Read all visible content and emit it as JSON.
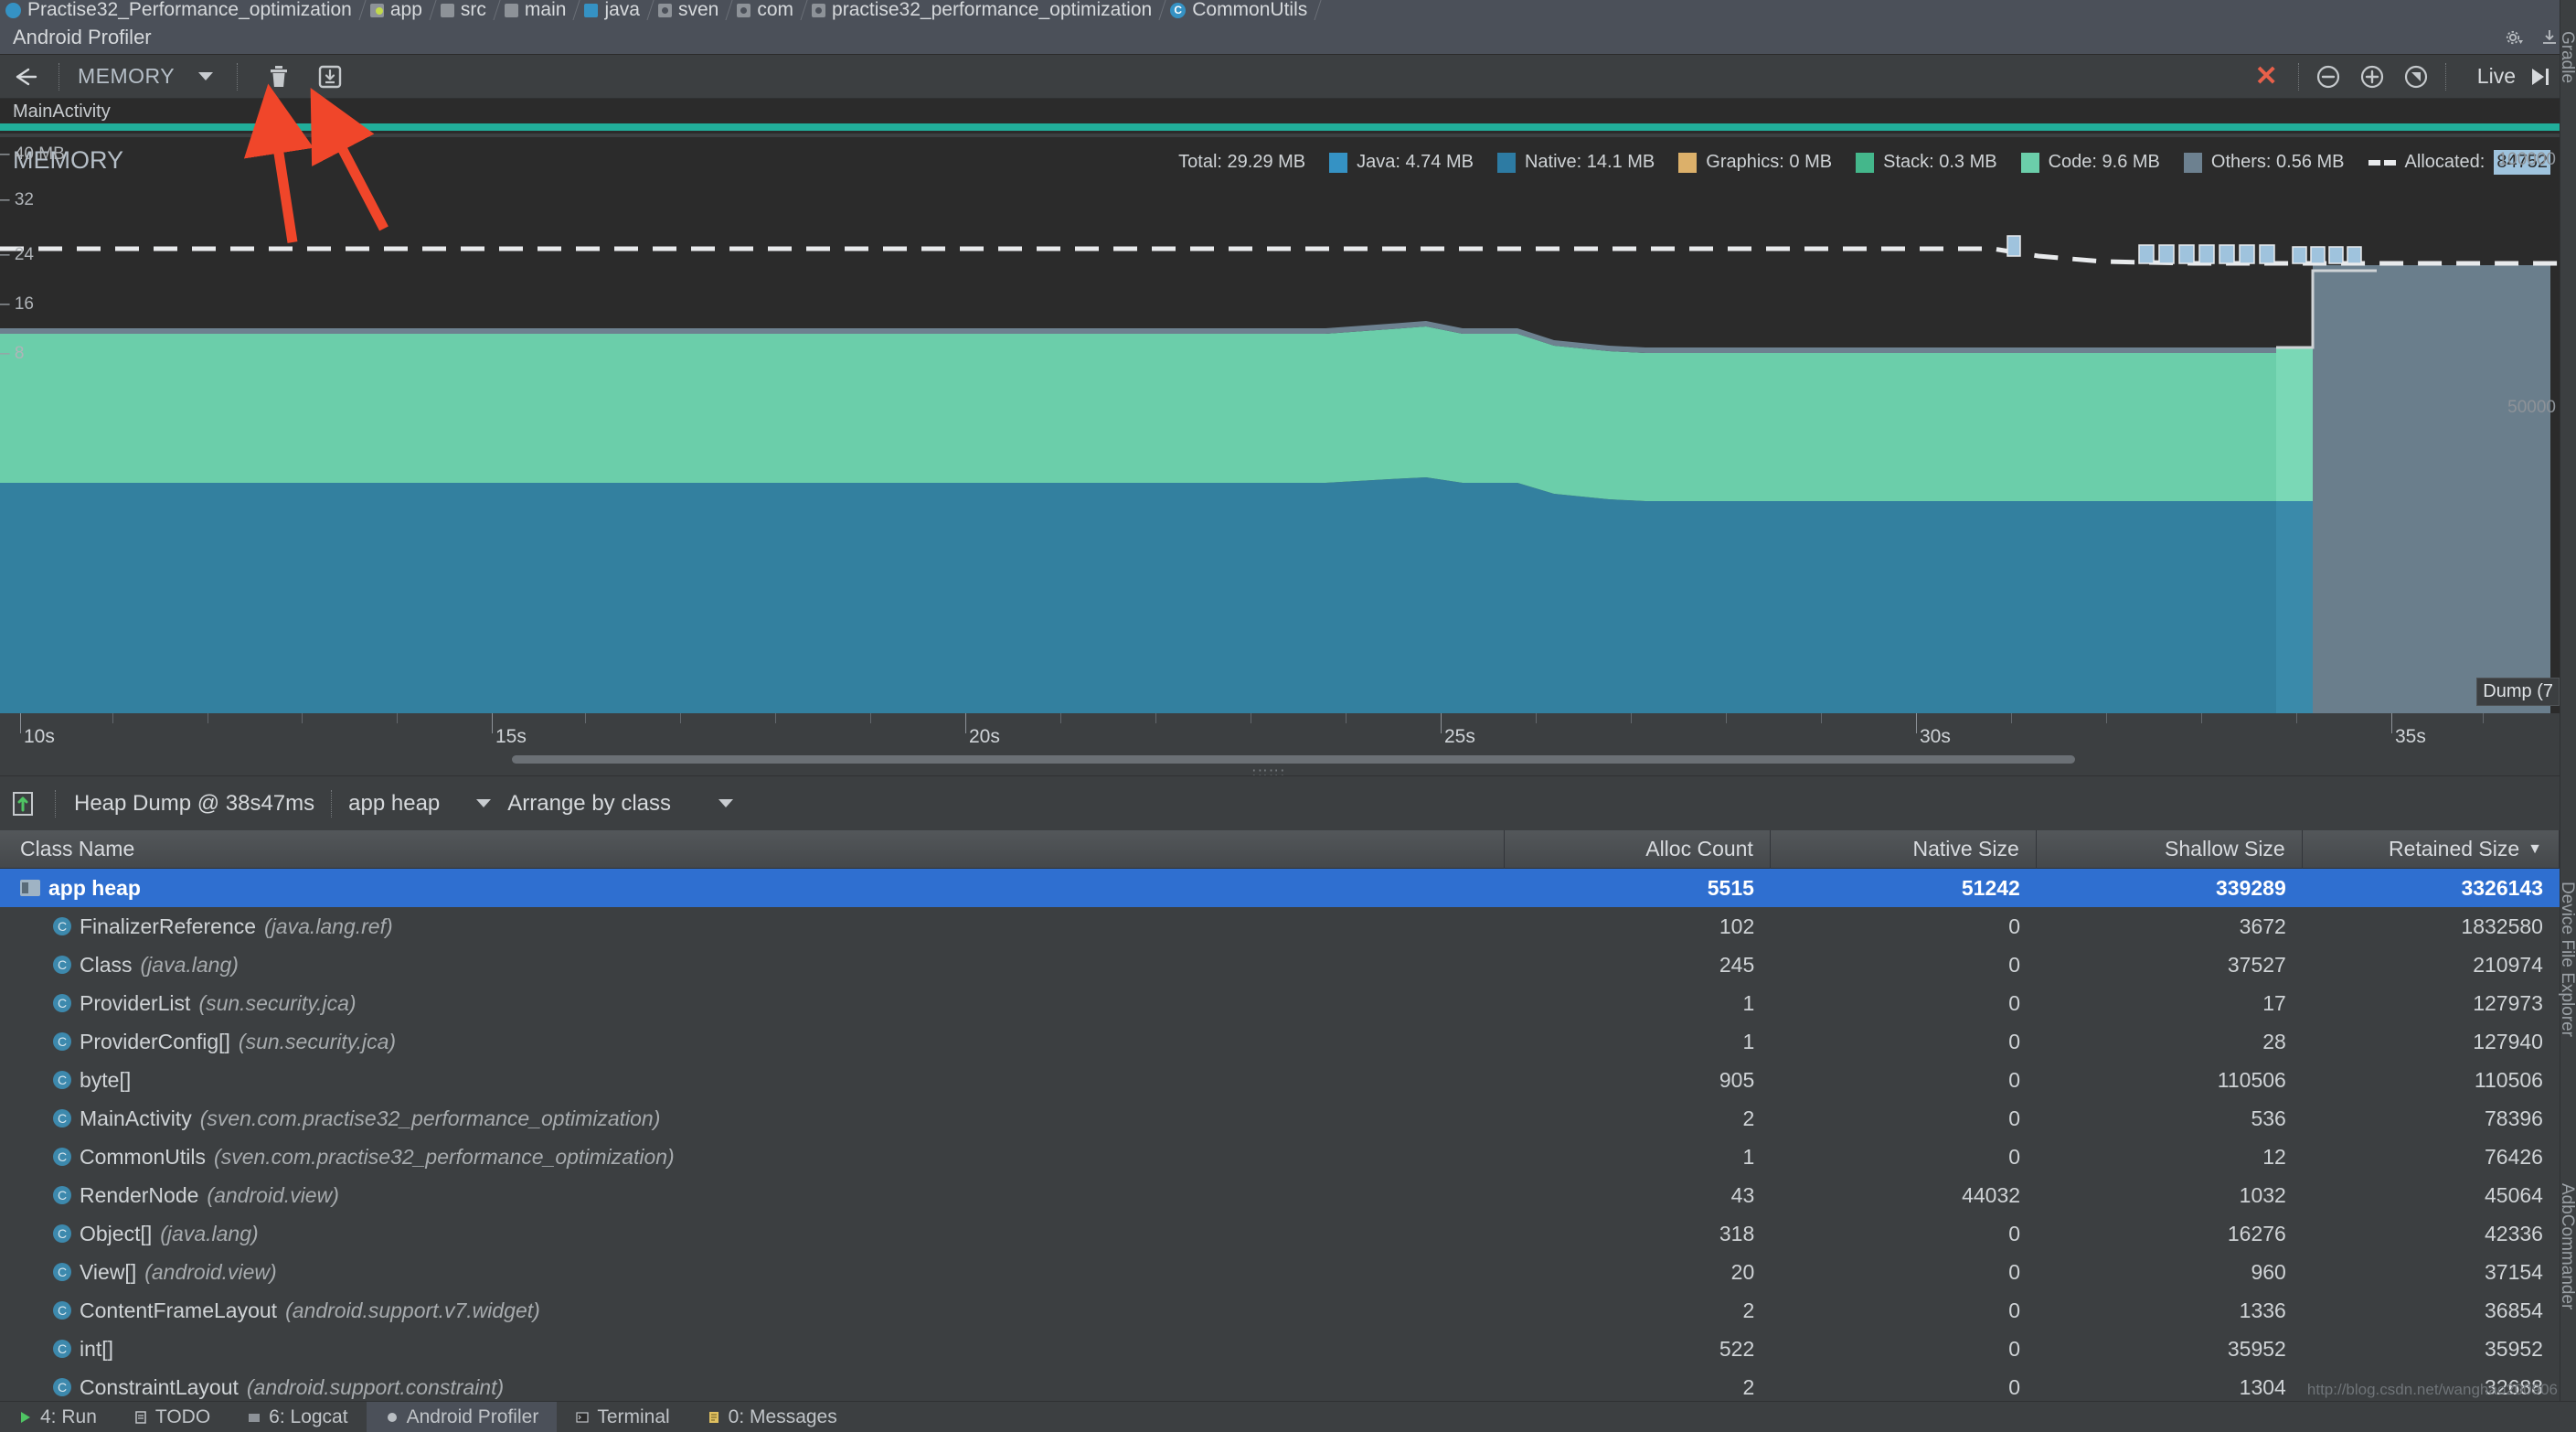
{
  "breadcrumb": [
    {
      "label": "Practise32_Performance_optimization",
      "icon": "project-icon"
    },
    {
      "label": "app",
      "icon": "module-app-icon"
    },
    {
      "label": "src",
      "icon": "folder-icon"
    },
    {
      "label": "main",
      "icon": "folder-icon"
    },
    {
      "label": "java",
      "icon": "source-folder-icon"
    },
    {
      "label": "sven",
      "icon": "package-icon"
    },
    {
      "label": "com",
      "icon": "package-icon"
    },
    {
      "label": "practise32_performance_optimization",
      "icon": "package-icon"
    },
    {
      "label": "CommonUtils",
      "icon": "class-icon"
    }
  ],
  "window": {
    "title": "Android Profiler",
    "settings_icon": "gear-icon",
    "minimize_icon": "hide-icon"
  },
  "toolbar": {
    "back_icon": "back-arrow-icon",
    "profiler_type": "MEMORY",
    "dropdown_icon": "chevron-down-icon",
    "trash_icon": "trash-icon",
    "heap_dump_icon": "heap-dump-icon",
    "stop_icon": "stop-x-icon",
    "zoom_out_icon": "zoom-out-icon",
    "zoom_in_icon": "zoom-in-icon",
    "reset_zoom_icon": "reset-zoom-icon",
    "live_label": "Live",
    "live_icon": "goto-live-icon"
  },
  "session": {
    "activity_name": "MainActivity",
    "activity_color": "#21ae9a"
  },
  "chart_data": {
    "type": "area",
    "title": "MEMORY",
    "xlabel": "",
    "ylabel": "MB",
    "ylim": [
      0,
      40
    ],
    "xlim": [
      8.5,
      38.5
    ],
    "grid": false,
    "legend_position": "top-right",
    "ytick_labels": [
      "40 MB",
      "32",
      "24",
      "16",
      "8"
    ],
    "ytick_values": [
      40,
      32,
      24,
      16,
      8
    ],
    "xtick_labels": [
      "10s",
      "15s",
      "20s",
      "25s",
      "30s",
      "35s"
    ],
    "xtick_values": [
      10,
      15,
      20,
      25,
      30,
      35
    ],
    "right_axis_labels": [
      "100000",
      "50000"
    ],
    "legend": [
      {
        "name": "Total",
        "value": "29.29 MB",
        "color": "",
        "swatch": false
      },
      {
        "name": "Java",
        "value": "4.74 MB",
        "color": "#3592c4",
        "swatch": true
      },
      {
        "name": "Native",
        "value": "14.1 MB",
        "color": "#2d7ba3",
        "swatch": true
      },
      {
        "name": "Graphics",
        "value": "0 MB",
        "color": "#dcb06a",
        "swatch": true
      },
      {
        "name": "Stack",
        "value": "0.3 MB",
        "color": "#44b78b",
        "swatch": true
      },
      {
        "name": "Code",
        "value": "9.6 MB",
        "color": "#6bceaa",
        "swatch": true
      },
      {
        "name": "Others",
        "value": "0.56 MB",
        "color": "#6d8190",
        "swatch": true
      },
      {
        "name": "Allocated",
        "value": "84752",
        "color": "#e8eaec",
        "swatch": false
      }
    ],
    "series": [
      {
        "name": "Native",
        "color": "#2d7ba3",
        "values": [
          16.0,
          16.0,
          16.0,
          16.0,
          16.0,
          16.0,
          16.0,
          16.0,
          16.0,
          16.0,
          16.0,
          16.0,
          16.0,
          16.0,
          16.0,
          16.0,
          16.0,
          16.0,
          16.0,
          16.0,
          16.0,
          16.0,
          16.0,
          16.0,
          16.0,
          16.1,
          16.2,
          16.1,
          16.0,
          16.0,
          16.0,
          16.0,
          16.0,
          15.5,
          15.3,
          15.2,
          15.2,
          15.2,
          15.2,
          15.2,
          15.2,
          15.2,
          15.2,
          15.2,
          15.2,
          15.2,
          15.2,
          15.2,
          15.2,
          15.2
        ]
      },
      {
        "name": "Java+Code+Stack",
        "color": "#6bceaa",
        "values": [
          26.2,
          26.2,
          26.2,
          26.2,
          26.2,
          26.2,
          26.2,
          26.2,
          26.2,
          26.2,
          26.2,
          26.2,
          26.2,
          26.2,
          26.2,
          26.2,
          26.2,
          26.2,
          26.2,
          26.2,
          26.2,
          26.2,
          26.2,
          26.2,
          26.2,
          26.3,
          26.4,
          26.3,
          26.2,
          26.2,
          26.2,
          26.2,
          26.2,
          25.6,
          25.5,
          25.5,
          25.5,
          25.5,
          25.5,
          25.5,
          25.5,
          25.5,
          25.5,
          25.5,
          25.5,
          25.5,
          25.5,
          25.5,
          29.3,
          29.3
        ]
      },
      {
        "name": "Allocated (dashed)",
        "color": "#e8eaec",
        "values": [
          34.9,
          34.9,
          34.9,
          34.9,
          34.9,
          34.9,
          34.9,
          34.9,
          34.9,
          34.9,
          34.9,
          34.9,
          34.9,
          34.9,
          34.9,
          34.9,
          34.9,
          34.9,
          34.9,
          34.9,
          34.9,
          34.9,
          34.9,
          34.9,
          34.9,
          34.9,
          34.9,
          34.9,
          34.9,
          34.9,
          34.9,
          34.9,
          34.6,
          34.1,
          33.8,
          33.6,
          33.6,
          33.6,
          33.6,
          33.6,
          33.6,
          33.6,
          33.6,
          33.6,
          33.6,
          33.6,
          33.6,
          33.6,
          33.6,
          33.6
        ]
      }
    ],
    "dump_marker": {
      "label": "Dump (7"
    }
  },
  "heap_toolbar": {
    "capture_icon": "heap-dump-capture-icon",
    "dump_label": "Heap Dump @ 38s47ms",
    "heap_select": "app heap",
    "heap_select_icon": "chevron-down-icon",
    "arrange_select": "Arrange by class",
    "arrange_select_icon": "chevron-down-icon"
  },
  "table": {
    "columns": [
      {
        "key": "name",
        "label": "Class Name",
        "align": "left"
      },
      {
        "key": "alloc",
        "label": "Alloc Count",
        "align": "right"
      },
      {
        "key": "native",
        "label": "Native Size",
        "align": "right"
      },
      {
        "key": "shallow",
        "label": "Shallow Size",
        "align": "right"
      },
      {
        "key": "retained",
        "label": "Retained Size",
        "align": "right",
        "sort": "desc",
        "sort_icon": "sort-desc-icon"
      }
    ],
    "rows": [
      {
        "name": "app heap",
        "pkg": "",
        "icon": "heap-folder-icon",
        "alloc": "5515",
        "native": "51242",
        "shallow": "339289",
        "retained": "3326143",
        "selected": true,
        "indent": 0
      },
      {
        "name": "FinalizerReference",
        "pkg": "(java.lang.ref)",
        "icon": "class-icon",
        "alloc": "102",
        "native": "0",
        "shallow": "3672",
        "retained": "1832580",
        "selected": false,
        "indent": 1
      },
      {
        "name": "Class",
        "pkg": "(java.lang)",
        "icon": "class-icon",
        "alloc": "245",
        "native": "0",
        "shallow": "37527",
        "retained": "210974",
        "selected": false,
        "indent": 1
      },
      {
        "name": "ProviderList",
        "pkg": "(sun.security.jca)",
        "icon": "class-icon",
        "alloc": "1",
        "native": "0",
        "shallow": "17",
        "retained": "127973",
        "selected": false,
        "indent": 1
      },
      {
        "name": "ProviderConfig[]",
        "pkg": "(sun.security.jca)",
        "icon": "class-icon",
        "alloc": "1",
        "native": "0",
        "shallow": "28",
        "retained": "127940",
        "selected": false,
        "indent": 1
      },
      {
        "name": "byte[]",
        "pkg": "",
        "icon": "class-icon",
        "alloc": "905",
        "native": "0",
        "shallow": "110506",
        "retained": "110506",
        "selected": false,
        "indent": 1
      },
      {
        "name": "MainActivity",
        "pkg": "(sven.com.practise32_performance_optimization)",
        "icon": "class-icon",
        "alloc": "2",
        "native": "0",
        "shallow": "536",
        "retained": "78396",
        "selected": false,
        "indent": 1
      },
      {
        "name": "CommonUtils",
        "pkg": "(sven.com.practise32_performance_optimization)",
        "icon": "class-icon",
        "alloc": "1",
        "native": "0",
        "shallow": "12",
        "retained": "76426",
        "selected": false,
        "indent": 1
      },
      {
        "name": "RenderNode",
        "pkg": "(android.view)",
        "icon": "class-icon",
        "alloc": "43",
        "native": "44032",
        "shallow": "1032",
        "retained": "45064",
        "selected": false,
        "indent": 1
      },
      {
        "name": "Object[]",
        "pkg": "(java.lang)",
        "icon": "class-icon",
        "alloc": "318",
        "native": "0",
        "shallow": "16276",
        "retained": "42336",
        "selected": false,
        "indent": 1
      },
      {
        "name": "View[]",
        "pkg": "(android.view)",
        "icon": "class-icon",
        "alloc": "20",
        "native": "0",
        "shallow": "960",
        "retained": "37154",
        "selected": false,
        "indent": 1
      },
      {
        "name": "ContentFrameLayout",
        "pkg": "(android.support.v7.widget)",
        "icon": "class-icon",
        "alloc": "2",
        "native": "0",
        "shallow": "1336",
        "retained": "36854",
        "selected": false,
        "indent": 1
      },
      {
        "name": "int[]",
        "pkg": "",
        "icon": "class-icon",
        "alloc": "522",
        "native": "0",
        "shallow": "35952",
        "retained": "35952",
        "selected": false,
        "indent": 1
      },
      {
        "name": "ConstraintLayout",
        "pkg": "(android.support.constraint)",
        "icon": "class-icon",
        "alloc": "2",
        "native": "0",
        "shallow": "1304",
        "retained": "32688",
        "selected": false,
        "indent": 1
      }
    ]
  },
  "right_rail": [
    {
      "label": "Gradle"
    },
    {
      "label": "Device File Explorer"
    },
    {
      "label": "AdbCommander"
    }
  ],
  "bottom_bar": [
    {
      "label": "4: Run",
      "icon": "run-icon",
      "active": false
    },
    {
      "label": "TODO",
      "icon": "todo-icon",
      "active": false
    },
    {
      "label": "6: Logcat",
      "icon": "logcat-icon",
      "active": false
    },
    {
      "label": "Android Profiler",
      "icon": "profiler-icon",
      "active": true
    },
    {
      "label": "Terminal",
      "icon": "terminal-icon",
      "active": false
    },
    {
      "label": "0: Messages",
      "icon": "messages-icon",
      "active": false
    }
  ],
  "watermark": "http://blog.csdn.net/wanghao200906"
}
